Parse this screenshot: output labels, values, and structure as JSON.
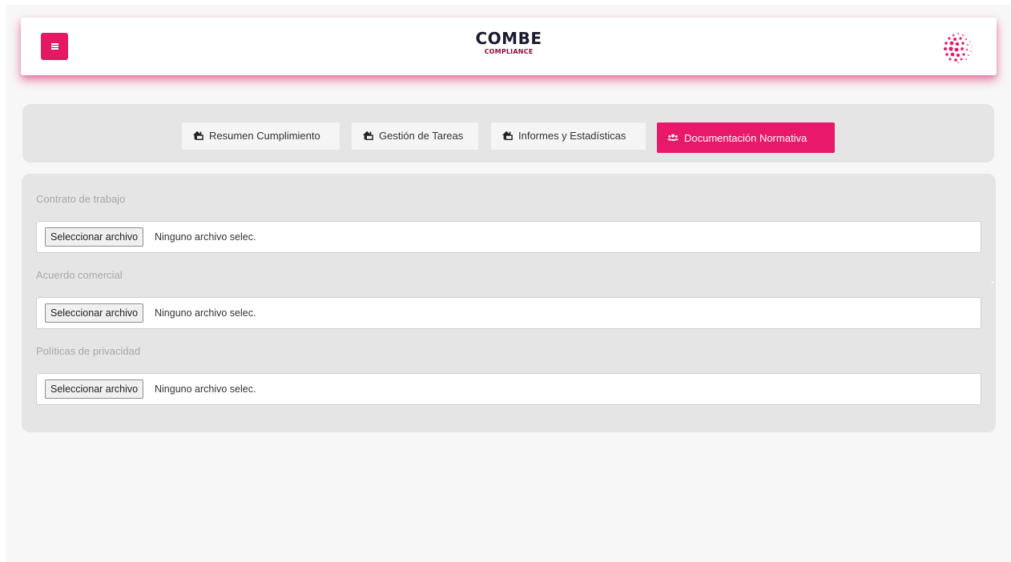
{
  "header": {
    "brand_title": "COMBE",
    "brand_subtitle": "COMPLIANCE",
    "menu_icon": "hamburger-icon",
    "logo_icon": "dotted-sphere-logo"
  },
  "tabs": [
    {
      "label": "Resumen Cumplimiento",
      "icon": "house-user-icon",
      "active": false
    },
    {
      "label": "Gestión de Tareas",
      "icon": "house-user-icon",
      "active": false
    },
    {
      "label": "Informes y Estadísticas",
      "icon": "house-user-icon",
      "active": false
    },
    {
      "label": "Documentación Normativa",
      "icon": "users-icon",
      "active": true
    }
  ],
  "form": {
    "fields": [
      {
        "label": "Contrato de trabajo",
        "button": "Seleccionar archivo",
        "status": "Ninguno archivo selec."
      },
      {
        "label": "Acuerdo comercial",
        "button": "Seleccionar archivo",
        "status": "Ninguno archivo selec."
      },
      {
        "label": "Políticas de privacidad",
        "button": "Seleccionar archivo",
        "status": "Ninguno archivo selec."
      }
    ]
  },
  "colors": {
    "accent": "#e8196a",
    "panel": "#e5e5e5",
    "page_bg": "#f7f7f7"
  }
}
